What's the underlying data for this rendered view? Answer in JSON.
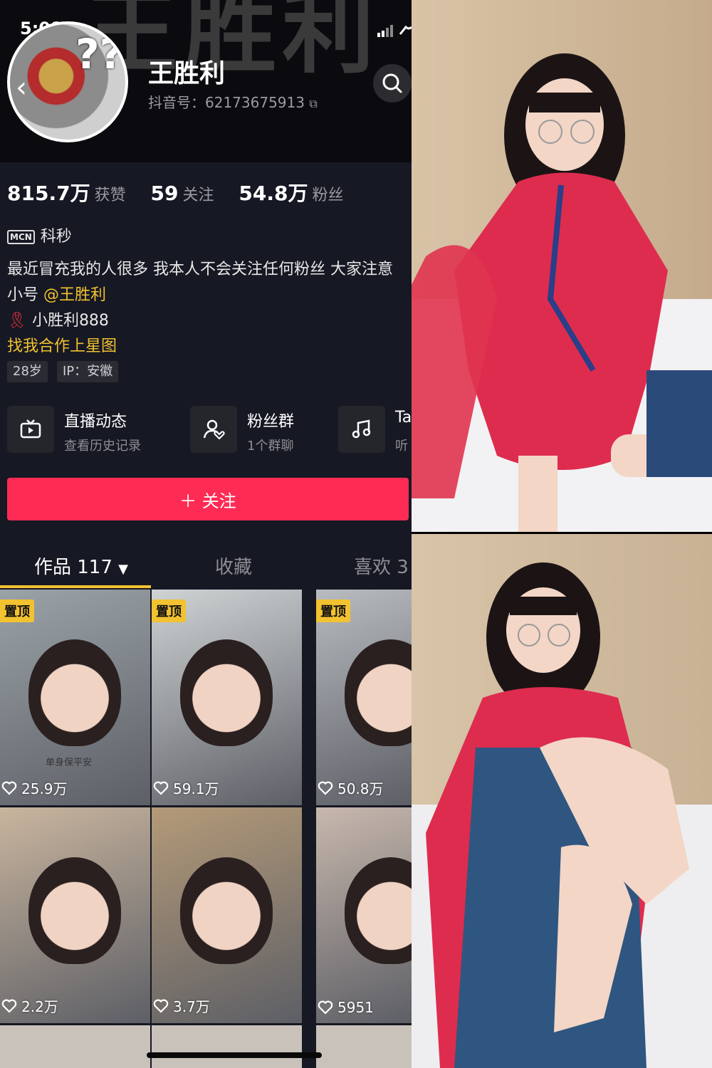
{
  "header": {
    "bg_title": "王胜利",
    "time": "5:08",
    "avatar_text": "??",
    "name": "王胜利",
    "douyin_id": "抖音号：62173675913"
  },
  "stats": [
    {
      "value": "815.7万",
      "label": "获赞"
    },
    {
      "value": "59",
      "label": "关注"
    },
    {
      "value": "54.8万",
      "label": "粉丝"
    }
  ],
  "mcn": {
    "tag": "MCN",
    "name": "科秒"
  },
  "bio": {
    "line1": "最近冒充我的人很多 我本人不会关注任何粉丝 大家注意",
    "line2_prefix": "小号",
    "line2_mention": "@王胜利",
    "line3": "小胜利888",
    "line4": "找我合作上星图"
  },
  "tags": [
    "28岁",
    "IP：安徽"
  ],
  "features": [
    {
      "title": "直播动态",
      "sub": "查看历史记录"
    },
    {
      "title": "粉丝群",
      "sub": "1个群聊"
    },
    {
      "title": "Ta",
      "sub": "听"
    }
  ],
  "follow_label": "＋ 关注",
  "tabs": [
    {
      "label": "作品 117",
      "active": true
    },
    {
      "label": "收藏",
      "active": false
    },
    {
      "label": "喜欢 3",
      "active": false
    }
  ],
  "videos": [
    {
      "pinned": "置顶",
      "likes": "25.9万",
      "caption": "单身保平安",
      "bg": "#9aa3a8"
    },
    {
      "pinned": "置顶",
      "likes": "59.1万",
      "caption": "",
      "bg": "#cfd3d4"
    },
    {
      "pinned": "置顶",
      "likes": "50.8万",
      "caption": "",
      "bg": "#b8bcc0"
    },
    {
      "pinned": "",
      "likes": "2.2万",
      "caption": "",
      "bg": "#c9b59e"
    },
    {
      "pinned": "",
      "likes": "3.7万",
      "caption": "",
      "bg": "#b49a78"
    },
    {
      "pinned": "",
      "likes": "5951",
      "caption": "",
      "bg": "#c8b8ad"
    }
  ],
  "colors": {
    "accent": "#fe2c55",
    "gold": "#f2c230",
    "page_bg": "#161823"
  }
}
